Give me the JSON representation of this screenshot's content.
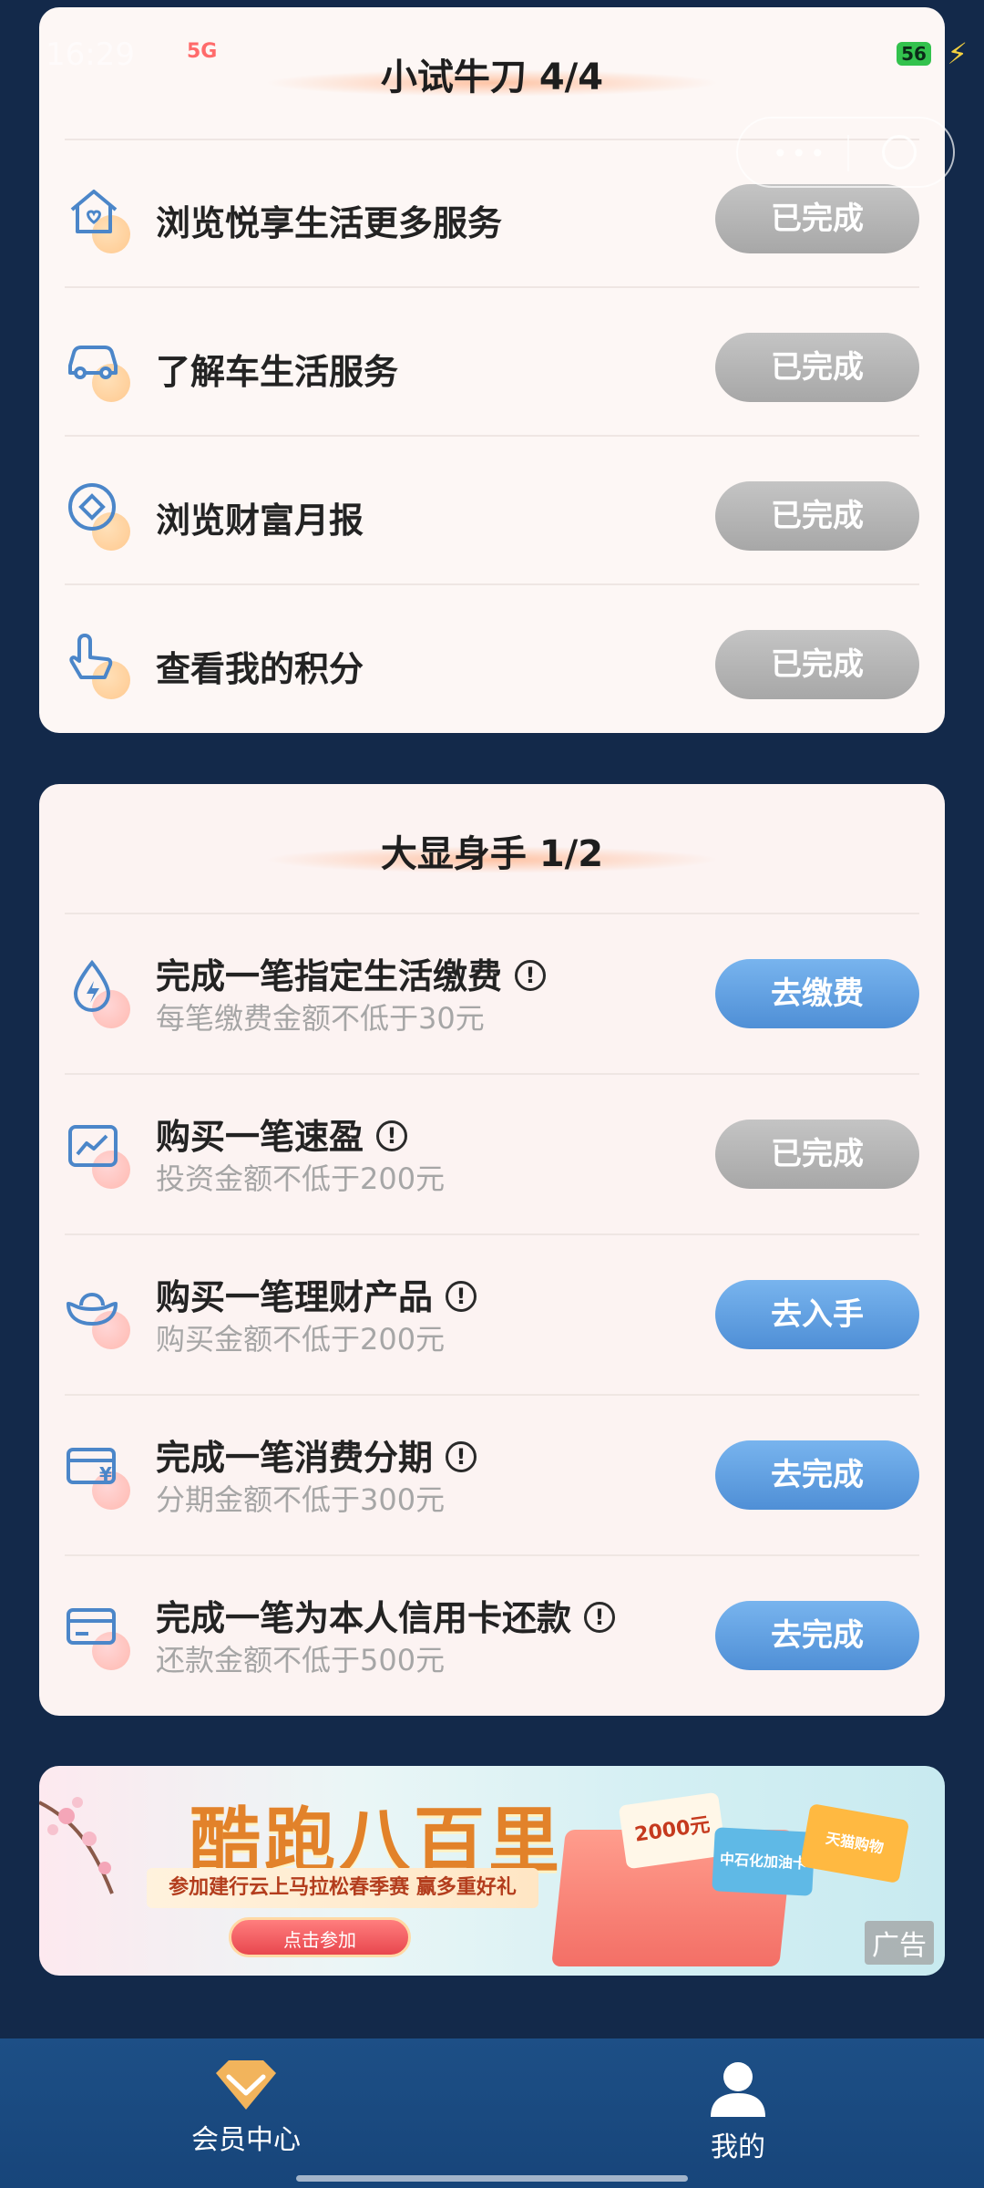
{
  "status_bar": {
    "time": "16:29",
    "network": "5G",
    "battery": "56"
  },
  "section_1": {
    "title": "小试牛刀 4/4",
    "tasks": [
      {
        "icon": "house-heart-icon",
        "title": "浏览悦享生活更多服务",
        "button": "已完成",
        "state": "done"
      },
      {
        "icon": "car-icon",
        "title": "了解车生活服务",
        "button": "已完成",
        "state": "done"
      },
      {
        "icon": "diamond-coin-icon",
        "title": "浏览财富月报",
        "button": "已完成",
        "state": "done"
      },
      {
        "icon": "hand-tap-icon",
        "title": "查看我的积分",
        "button": "已完成",
        "state": "done"
      }
    ]
  },
  "section_2": {
    "title": "大显身手 1/2",
    "tasks": [
      {
        "icon": "water-drop-bolt-icon",
        "title": "完成一笔指定生活缴费",
        "subtitle": "每笔缴费金额不低于30元",
        "button": "去缴费",
        "state": "todo"
      },
      {
        "icon": "chart-line-icon",
        "title": "购买一笔速盈",
        "subtitle": "投资金额不低于200元",
        "button": "已完成",
        "state": "done"
      },
      {
        "icon": "gold-ingot-icon",
        "title": "购买一笔理财产品",
        "subtitle": "购买金额不低于200元",
        "button": "去入手",
        "state": "todo"
      },
      {
        "icon": "card-yuan-icon",
        "title": "完成一笔消费分期",
        "subtitle": "分期金额不低于300元",
        "button": "去完成",
        "state": "todo"
      },
      {
        "icon": "credit-card-icon",
        "title": "完成一笔为本人信用卡还款",
        "subtitle": "还款金额不低于500元",
        "button": "去完成",
        "state": "todo"
      }
    ]
  },
  "banner": {
    "headline": "酷跑八百里",
    "ribbon": "参加建行云上马拉松春季赛 赢多重好礼",
    "cta": "点击参加",
    "coupon_1": "2000元",
    "coupon_2": "中石化加油卡",
    "coupon_3": "天猫购物",
    "ad_label": "广告"
  },
  "tabbar": {
    "items": [
      {
        "label": "会员中心",
        "icon": "diamond-icon"
      },
      {
        "label": "我的",
        "icon": "user-icon"
      }
    ]
  },
  "colors": {
    "background": "#13294a",
    "card": "#fdf7f5",
    "button_done": "#b5b5b5",
    "button_go": "#5c9ce0",
    "tabbar": "#1a4a80"
  }
}
